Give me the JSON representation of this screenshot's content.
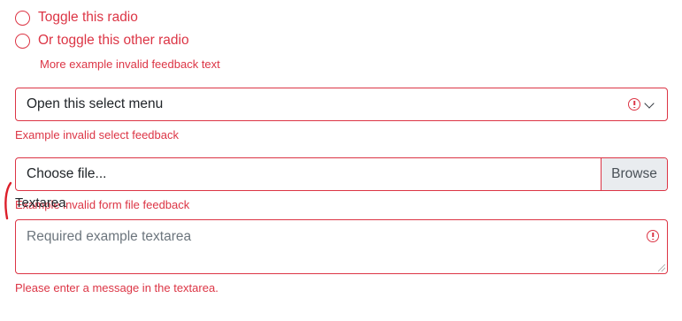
{
  "colors": {
    "invalid": "#dc3545",
    "annotation": "#dc1f2a"
  },
  "radios": [
    {
      "label": "Toggle this radio",
      "checked": false
    },
    {
      "label": "Or toggle this other radio",
      "checked": false
    }
  ],
  "radio_feedback": "More example invalid feedback text",
  "select": {
    "value": "Open this select menu",
    "icon": "chevron-down-icon"
  },
  "select_feedback": "Example invalid select feedback",
  "file": {
    "placeholder": "Choose file...",
    "button_label": "Browse"
  },
  "file_feedback": "Example invalid form file feedback",
  "textarea": {
    "label": "Textarea",
    "placeholder": "Required example textarea"
  },
  "textarea_feedback": "Please enter a message in the textarea."
}
